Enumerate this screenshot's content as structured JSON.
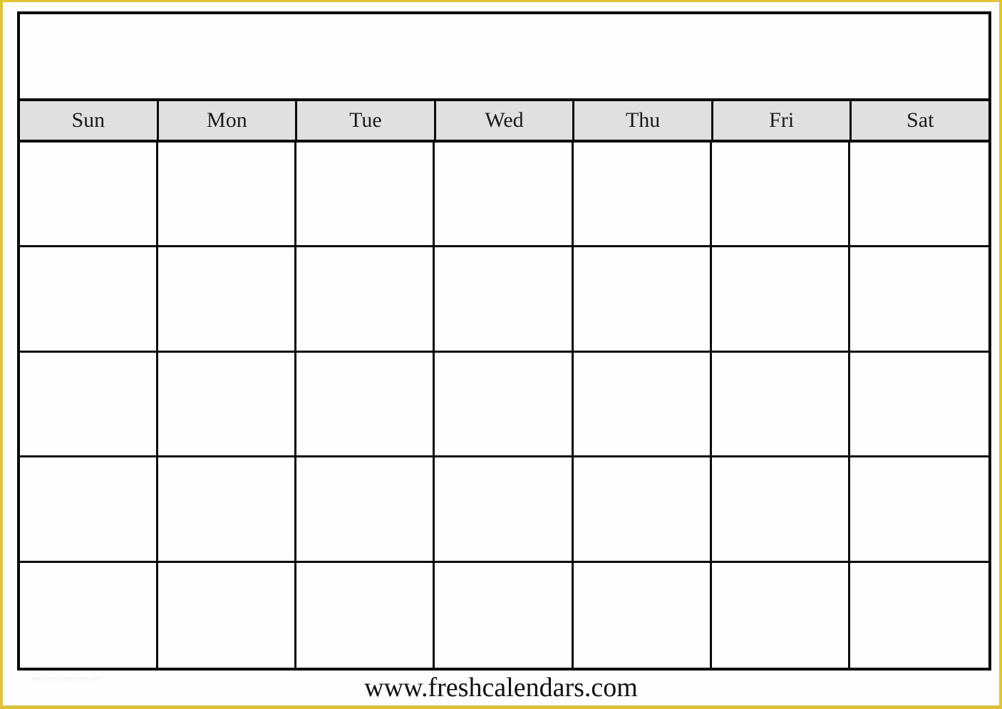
{
  "calendar": {
    "title": "",
    "weekdays": [
      "Sun",
      "Mon",
      "Tue",
      "Wed",
      "Thu",
      "Fri",
      "Sat"
    ],
    "weeks": [
      [
        "",
        "",
        "",
        "",
        "",
        "",
        ""
      ],
      [
        "",
        "",
        "",
        "",
        "",
        "",
        ""
      ],
      [
        "",
        "",
        "",
        "",
        "",
        "",
        ""
      ],
      [
        "",
        "",
        "",
        "",
        "",
        "",
        ""
      ],
      [
        "",
        "",
        "",
        "",
        "",
        "",
        ""
      ]
    ]
  },
  "footer": {
    "url": "www.freshcalendars.com",
    "credit": "www.freshcalendars.com"
  },
  "colors": {
    "frame": "#e0c437",
    "grid_lines": "#0a0a0a",
    "header_bg": "#e0e0e0"
  }
}
